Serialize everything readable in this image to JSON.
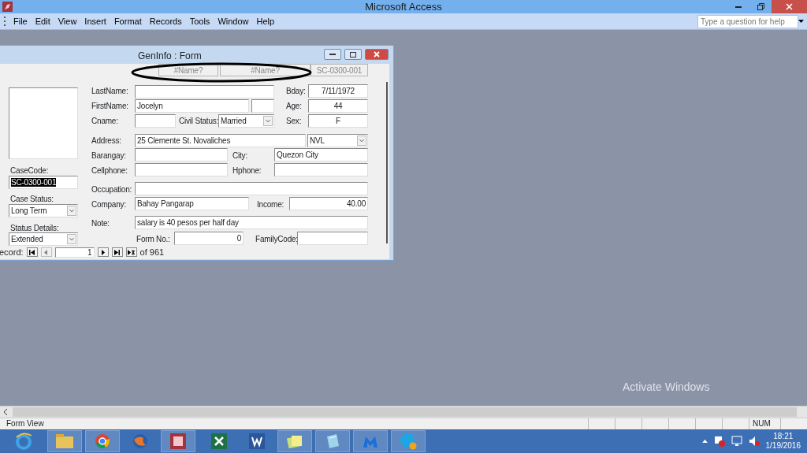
{
  "app": {
    "title": "Microsoft Access",
    "menu": [
      "File",
      "Edit",
      "View",
      "Insert",
      "Format",
      "Records",
      "Tools",
      "Window",
      "Help"
    ],
    "help_placeholder": "Type a question for help"
  },
  "form": {
    "title": "GenInfo : Form",
    "controls": [
      {
        "kind": "readonly",
        "value": "#Name?"
      },
      {
        "kind": "readonly",
        "value": "#Name?"
      },
      {
        "kind": "readonly",
        "value": "SC-0300-001"
      },
      {
        "kind": "picture"
      },
      {
        "kind": "label",
        "text": "LastName:"
      },
      {
        "kind": "text"
      },
      {
        "kind": "label",
        "text": "Bday:"
      },
      {
        "kind": "center",
        "value": "7/11/1972"
      },
      {
        "kind": "label",
        "text": "FirstName:"
      },
      {
        "kind": "text",
        "value": "Jocelyn"
      },
      {
        "kind": "text"
      },
      {
        "kind": "label",
        "text": "Age:"
      },
      {
        "kind": "center",
        "value": "44"
      },
      {
        "kind": "label",
        "text": "Cname:"
      },
      {
        "kind": "text"
      },
      {
        "kind": "label",
        "text": "Civil Status:"
      },
      {
        "kind": "combo",
        "value": "Married"
      },
      {
        "kind": "label",
        "text": "Sex:"
      },
      {
        "kind": "center",
        "value": "F"
      },
      {
        "kind": "label",
        "text": "Address:"
      },
      {
        "kind": "text",
        "value": "25 Clemente St. Novaliches"
      },
      {
        "kind": "combo",
        "value": "NVL"
      },
      {
        "kind": "label",
        "text": "Barangay:"
      },
      {
        "kind": "text"
      },
      {
        "kind": "label",
        "text": "City:"
      },
      {
        "kind": "text",
        "value": "Quezon City"
      },
      {
        "kind": "label",
        "text": "Cellphone:"
      },
      {
        "kind": "text"
      },
      {
        "kind": "label",
        "text": "Hphone:"
      },
      {
        "kind": "text"
      },
      {
        "kind": "label",
        "text": "Occupation:"
      },
      {
        "kind": "text"
      },
      {
        "kind": "label",
        "text": "Company:"
      },
      {
        "kind": "text",
        "value": "Bahay Pangarap"
      },
      {
        "kind": "label",
        "text": "Income:"
      },
      {
        "kind": "number",
        "value": "40.00"
      },
      {
        "kind": "label",
        "text": "Note:"
      },
      {
        "kind": "text",
        "value": "salary is 40 pesos per half day"
      },
      {
        "kind": "label",
        "text": "Form No.:"
      },
      {
        "kind": "number",
        "value": "0"
      },
      {
        "kind": "label",
        "text": "FamilyCode:"
      },
      {
        "kind": "text"
      },
      {
        "kind": "label",
        "text": "CaseCode:"
      },
      {
        "kind": "text",
        "value": "SC-0300-001",
        "highlighted": true
      },
      {
        "kind": "label",
        "text": "Case Status:"
      },
      {
        "kind": "combo",
        "value": "Long Term"
      },
      {
        "kind": "label",
        "text": "Status Details:"
      },
      {
        "kind": "combo",
        "value": "Extended"
      }
    ],
    "navigation": {
      "label": "ecord:",
      "record": "1",
      "total": "of 961",
      "prev_disabled": true
    }
  },
  "watermark_text": "Activate Windows",
  "status_bar": {
    "text": "Form View",
    "indicator": "NUM"
  },
  "taskbar": {
    "time": "18:21",
    "date": "1/19/2016"
  }
}
